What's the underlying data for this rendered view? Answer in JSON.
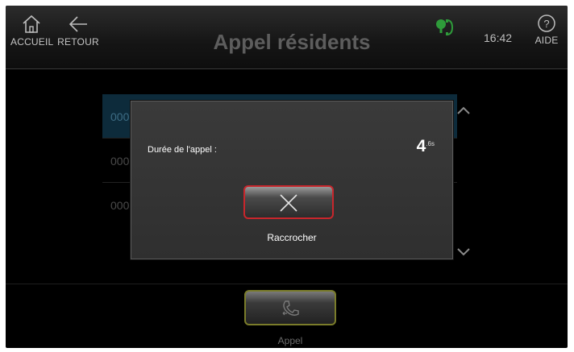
{
  "header": {
    "home_label": "ACCUEIL",
    "back_label": "RETOUR",
    "title": "Appel résidents",
    "time": "16:42",
    "help_label": "AIDE",
    "status_icon": "phone-connected-icon"
  },
  "list": {
    "rows": [
      {
        "text": "000"
      },
      {
        "text": "000"
      },
      {
        "text": "000"
      }
    ],
    "selected_index": 0
  },
  "dialog": {
    "duration_label": "Durée de l'appel :",
    "duration_value": "4",
    "duration_suffix": ".6s",
    "hangup_icon": "close-icon",
    "hangup_label": "Raccrocher"
  },
  "bottom": {
    "call_label": "Appel",
    "call_icon": "phone-icon"
  },
  "colors": {
    "hangup_border": "#c8262c",
    "call_border": "#7a7c2a",
    "status_green": "#2e9b3a"
  }
}
